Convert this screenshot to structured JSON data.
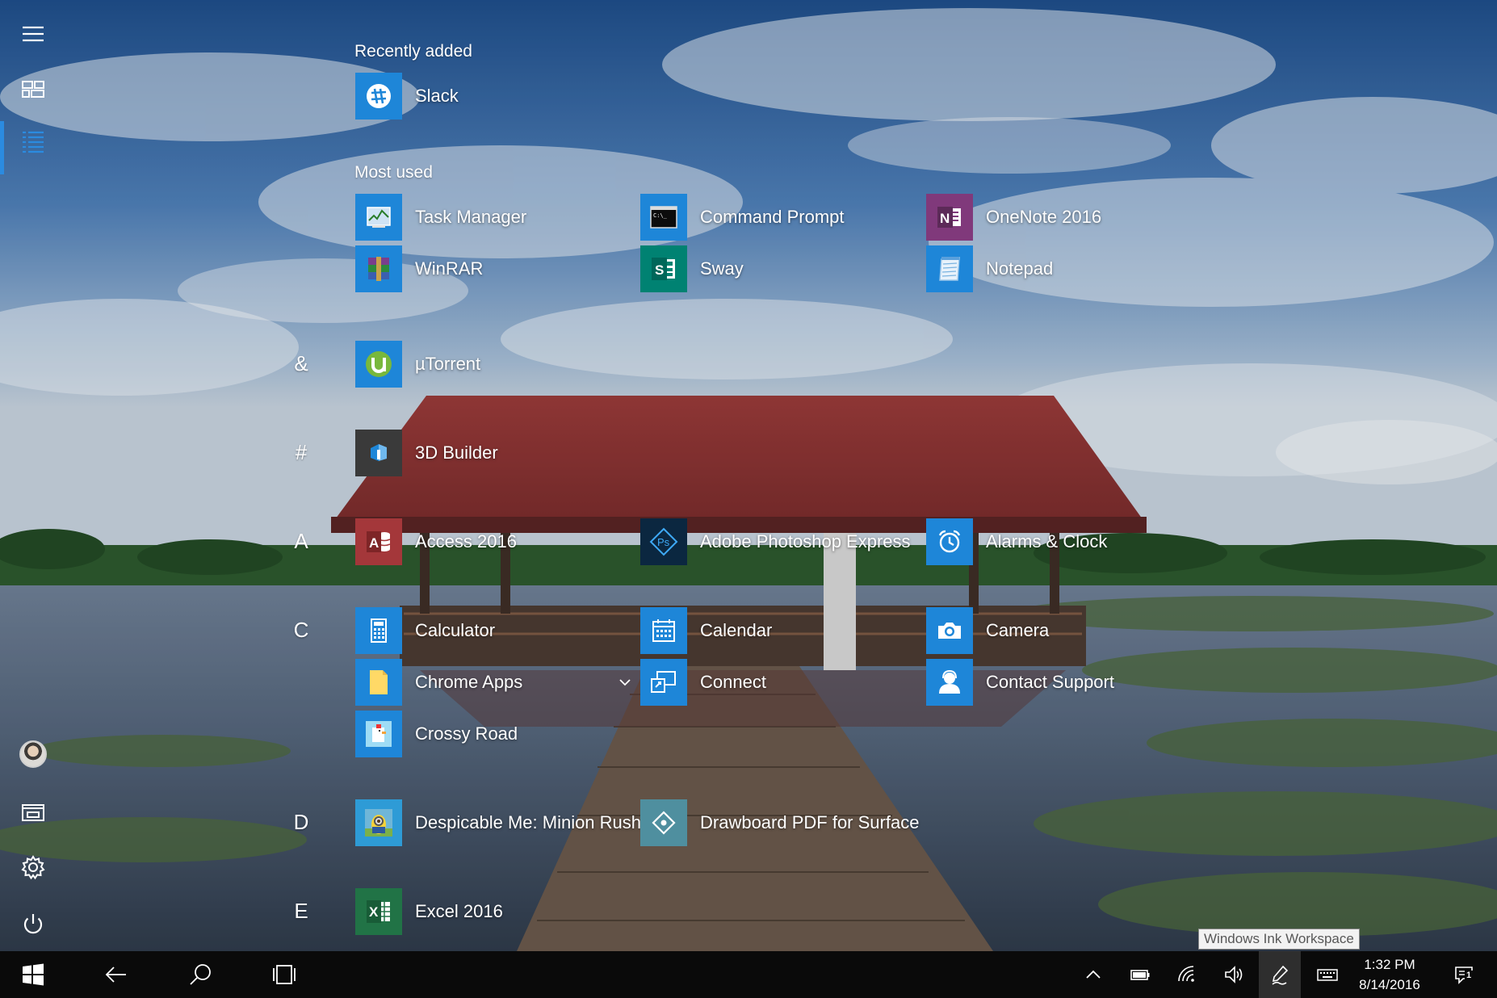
{
  "rail": {
    "items": [
      {
        "name": "menu",
        "icon": "hamburger-icon"
      },
      {
        "name": "tiles",
        "icon": "tiles-icon"
      },
      {
        "name": "all-apps",
        "icon": "all-apps-list-icon",
        "active": true
      },
      {
        "name": "user",
        "icon": "avatar"
      },
      {
        "name": "file-explorer",
        "icon": "file-explorer-icon"
      },
      {
        "name": "settings",
        "icon": "gear-icon"
      },
      {
        "name": "power",
        "icon": "power-icon"
      }
    ]
  },
  "sections": {
    "recently_added": "Recently added",
    "most_used": "Most used"
  },
  "letters": {
    "amp": "&",
    "hash": "#",
    "a": "A",
    "c": "C",
    "d": "D",
    "e": "E"
  },
  "apps": {
    "slack": {
      "label": "Slack",
      "color": "#1e86d8"
    },
    "task_manager": {
      "label": "Task Manager",
      "color": "#1e86d8"
    },
    "command_prompt": {
      "label": "Command Prompt",
      "color": "#1e86d8"
    },
    "onenote": {
      "label": "OneNote 2016",
      "color": "#80397b"
    },
    "winrar": {
      "label": "WinRAR",
      "color": "#1e86d8"
    },
    "sway": {
      "label": "Sway",
      "color": "#008272"
    },
    "notepad": {
      "label": "Notepad",
      "color": "#1e86d8"
    },
    "utorrent": {
      "label": "µTorrent",
      "color": "#1e86d8"
    },
    "builder_3d": {
      "label": "3D Builder",
      "color": "#3a3a3a"
    },
    "access": {
      "label": "Access 2016",
      "color": "#a4373a"
    },
    "photoshop_express": {
      "label": "Adobe Photoshop Express",
      "color": "#0b2740"
    },
    "alarms": {
      "label": "Alarms & Clock",
      "color": "#1e86d8"
    },
    "calculator": {
      "label": "Calculator",
      "color": "#1e86d8"
    },
    "calendar": {
      "label": "Calendar",
      "color": "#1e86d8"
    },
    "camera": {
      "label": "Camera",
      "color": "#1e86d8"
    },
    "chrome_apps": {
      "label": "Chrome Apps",
      "color": "#1e86d8"
    },
    "connect": {
      "label": "Connect",
      "color": "#1e86d8"
    },
    "contact_support": {
      "label": "Contact Support",
      "color": "#1e86d8"
    },
    "crossy_road": {
      "label": "Crossy Road",
      "color": "#1e86d8"
    },
    "despicable_me": {
      "label": "Despicable Me: Minion Rush",
      "color": "#2e9bd6"
    },
    "drawboard": {
      "label": "Drawboard PDF for Surface",
      "color": "#4f8f9f"
    },
    "excel": {
      "label": "Excel 2016",
      "color": "#217346"
    }
  },
  "taskbar": {
    "start": "windows-logo-icon",
    "back": "back-arrow-icon",
    "search": "search-icon",
    "task_view": "task-view-icon",
    "tray": [
      "chevron-up-icon",
      "battery-icon",
      "wifi-icon",
      "volume-icon",
      "pen-icon",
      "keyboard-icon"
    ],
    "time": "1:32 PM",
    "date": "8/14/2016",
    "notifications_count": "1",
    "tooltip": "Windows Ink Workspace"
  }
}
